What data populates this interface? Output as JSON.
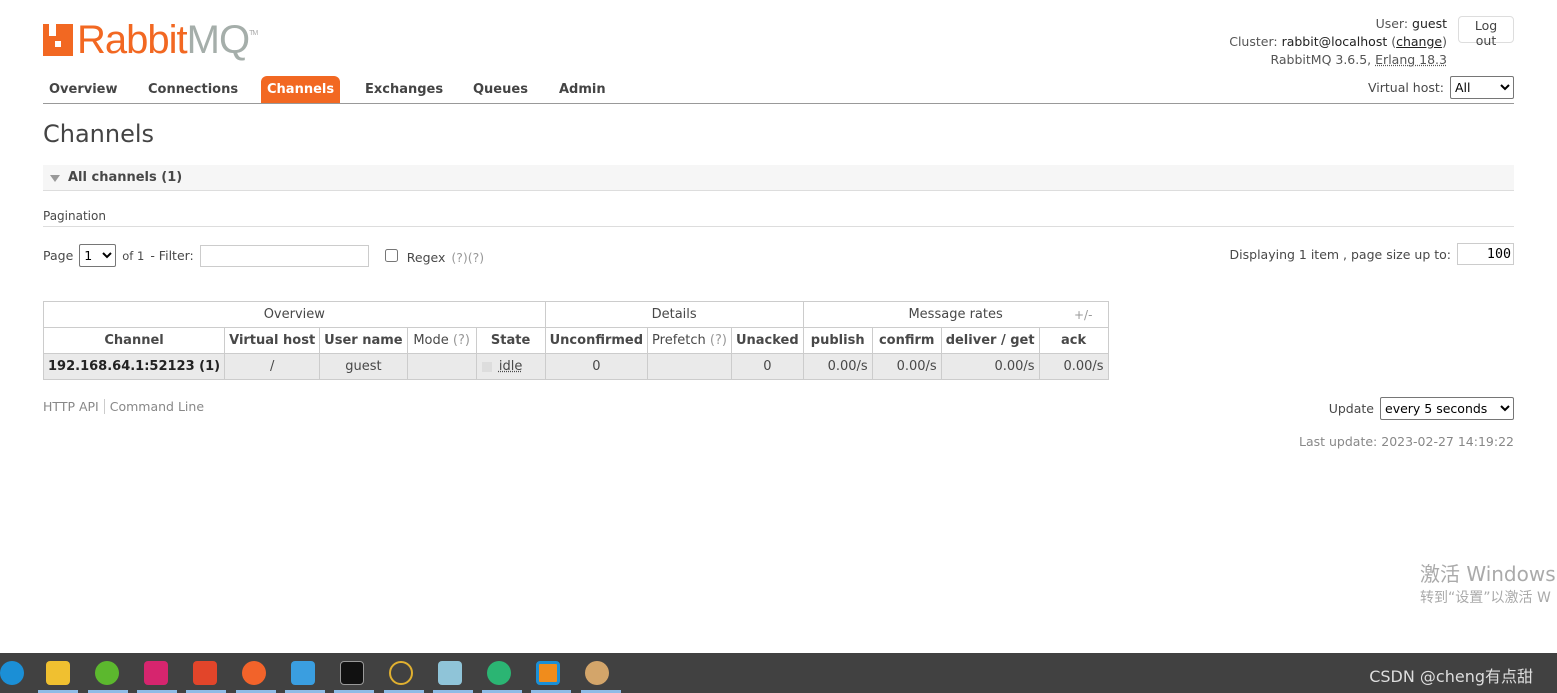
{
  "logo": {
    "rabbit": "Rabbit",
    "mq": "MQ",
    "tm": "TM"
  },
  "nav": [
    {
      "label": "Overview"
    },
    {
      "label": "Connections"
    },
    {
      "label": "Channels",
      "active": true
    },
    {
      "label": "Exchanges"
    },
    {
      "label": "Queues"
    },
    {
      "label": "Admin"
    }
  ],
  "header": {
    "user_label": "User:",
    "user": "guest",
    "cluster_label": "Cluster:",
    "cluster": "rabbit@localhost",
    "change": "change",
    "version": "RabbitMQ 3.6.5,",
    "erlang": "Erlang 18.3",
    "logout": "Log out",
    "vhost_label": "Virtual host:",
    "vhost_value": "All"
  },
  "page_title": "Channels",
  "section": "All channels (1)",
  "pagination": {
    "title": "Pagination",
    "page_label": "Page",
    "page": "1",
    "of": "of 1",
    "filter_label": "- Filter:",
    "filter_value": "",
    "regex": "Regex",
    "regex_help": "(?)(?)",
    "displaying": "Displaying 1 item , page size up to:",
    "page_size": "100"
  },
  "table": {
    "groups": [
      "Overview",
      "Details",
      "Message rates"
    ],
    "columns": [
      "Channel",
      "Virtual host",
      "User name",
      "Mode",
      "State",
      "Unconfirmed",
      "Prefetch",
      "Unacked",
      "publish",
      "confirm",
      "deliver / get",
      "ack"
    ],
    "help": "(?)",
    "rows": [
      {
        "channel": "192.168.64.1:52123 (1)",
        "vhost": "/",
        "user": "guest",
        "mode": "",
        "state": "idle",
        "unconfirmed": "0",
        "prefetch": "",
        "unacked": "0",
        "publish": "0.00/s",
        "confirm": "0.00/s",
        "deliver": "0.00/s",
        "ack": "0.00/s"
      }
    ],
    "plusminus": "+/-"
  },
  "footer": {
    "http_api": "HTTP API",
    "command_line": "Command Line",
    "update_label": "Update",
    "update_value": "every 5 seconds",
    "last_update": "Last update: 2023-02-27 14:19:22"
  },
  "watermark": {
    "line1": "激活 Windows",
    "line2": "转到“设置”以激活 W"
  },
  "taskbar": {
    "tray_text": "CSDN @cheng有点甜"
  },
  "colors": {
    "accent": "#f26822",
    "taskbar": "#414141"
  }
}
